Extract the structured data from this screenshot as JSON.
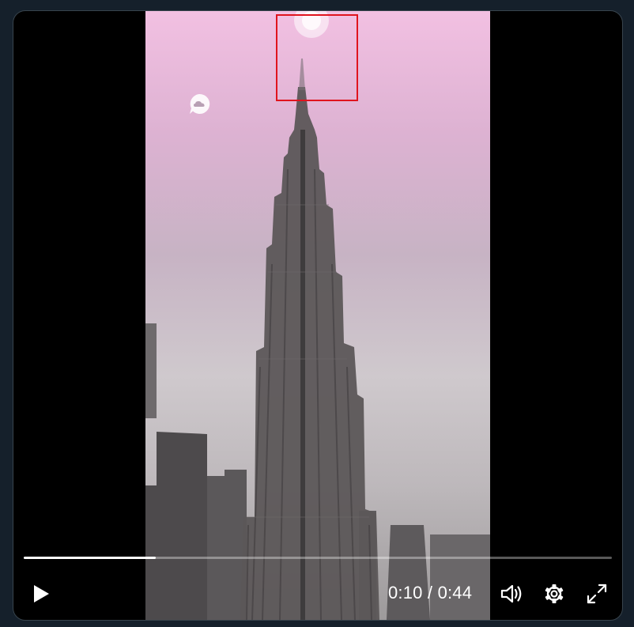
{
  "player": {
    "current_time": "0:10",
    "separator": " / ",
    "duration": "0:44",
    "progress_fraction": 0.225
  },
  "icons": {
    "play": "play-icon",
    "volume": "volume-icon",
    "settings": "gear-icon",
    "fullscreen": "fullscreen-icon",
    "watermark": "cloud-chat-icon"
  },
  "colors": {
    "page_background": "#15202b",
    "player_background": "#000000",
    "highlight_box": "#e0141e",
    "progress_fill": "#ffffff"
  }
}
